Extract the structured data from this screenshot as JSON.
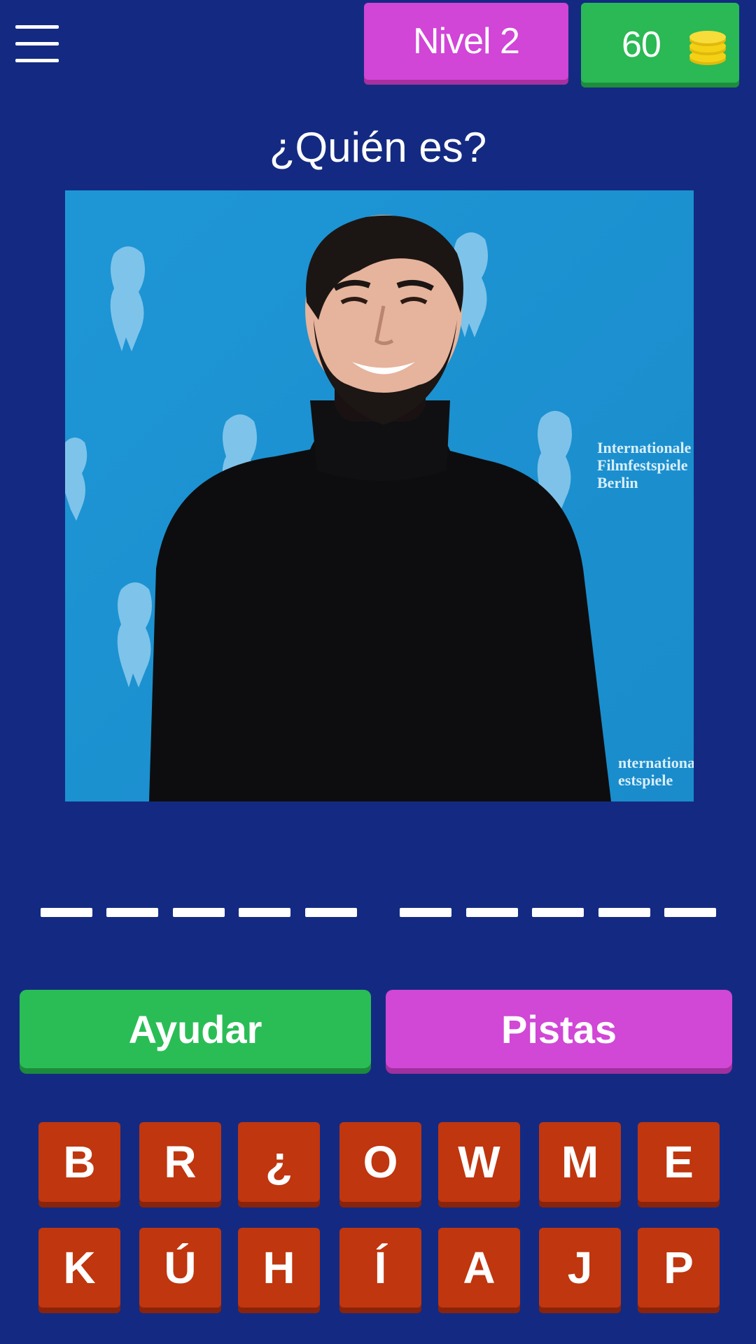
{
  "header": {
    "menu_icon": "hamburger-menu-icon",
    "level_label": "Nivel 2",
    "coins": "60",
    "coins_icon": "coin-stack-icon"
  },
  "question": "¿Quién es?",
  "photo": {
    "subject": "smiling bearded man in a black turtleneck in front of a blue Berlinale backdrop",
    "backdrop_text": "Internationale Filmfestspiele Berlin",
    "backdrop_text_bottom": "nternationale estspiele"
  },
  "answer": {
    "words": [
      5,
      5
    ]
  },
  "actions": {
    "help_label": "Ayudar",
    "hints_label": "Pistas"
  },
  "keyboard": {
    "rows": [
      [
        "B",
        "R",
        "¿",
        "O",
        "W",
        "M",
        "E"
      ],
      [
        "K",
        "Ú",
        "H",
        "Í",
        "A",
        "J",
        "P"
      ]
    ]
  },
  "colors": {
    "background": "#142a82",
    "level_badge": "#d145d7",
    "coins_badge": "#2ab954",
    "help_button": "#2abd56",
    "hints_button": "#d147d6",
    "key": "#bf360f",
    "coin": "#f5d116"
  }
}
